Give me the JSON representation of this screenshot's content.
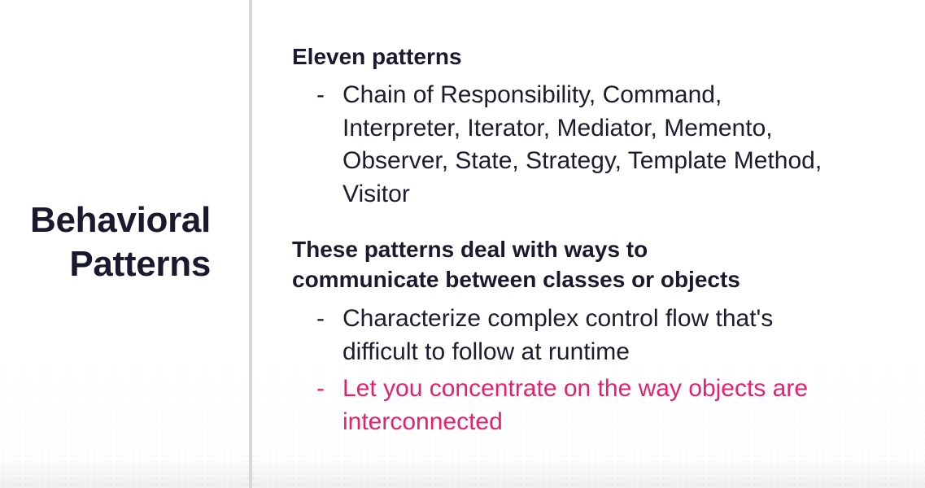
{
  "slide": {
    "title_lines": [
      "Behavioral",
      "Patterns"
    ],
    "blocks": [
      {
        "heading_lines": [
          "Eleven patterns"
        ],
        "bullets": [
          {
            "dash": "-",
            "lines": [
              "Chain of Responsibility, Command,",
              "Interpreter, Iterator, Mediator, Memento,",
              "Observer, State, Strategy, Template Method,",
              "Visitor"
            ]
          }
        ]
      },
      {
        "heading_lines": [
          "These patterns deal with ways to",
          "communicate between classes or objects"
        ],
        "bullets": [
          {
            "dash": "-",
            "lines": [
              "Characterize complex control flow that's",
              "difficult to follow at runtime"
            ]
          },
          {
            "dash": "-",
            "lines": [
              "Let you concentrate on the way objects are",
              "interconnected"
            ]
          }
        ]
      }
    ]
  },
  "colors": {
    "background": "#ffffff",
    "text": "#1c1c2e",
    "accent": "#e5206f",
    "divider": "#d7d7db"
  }
}
